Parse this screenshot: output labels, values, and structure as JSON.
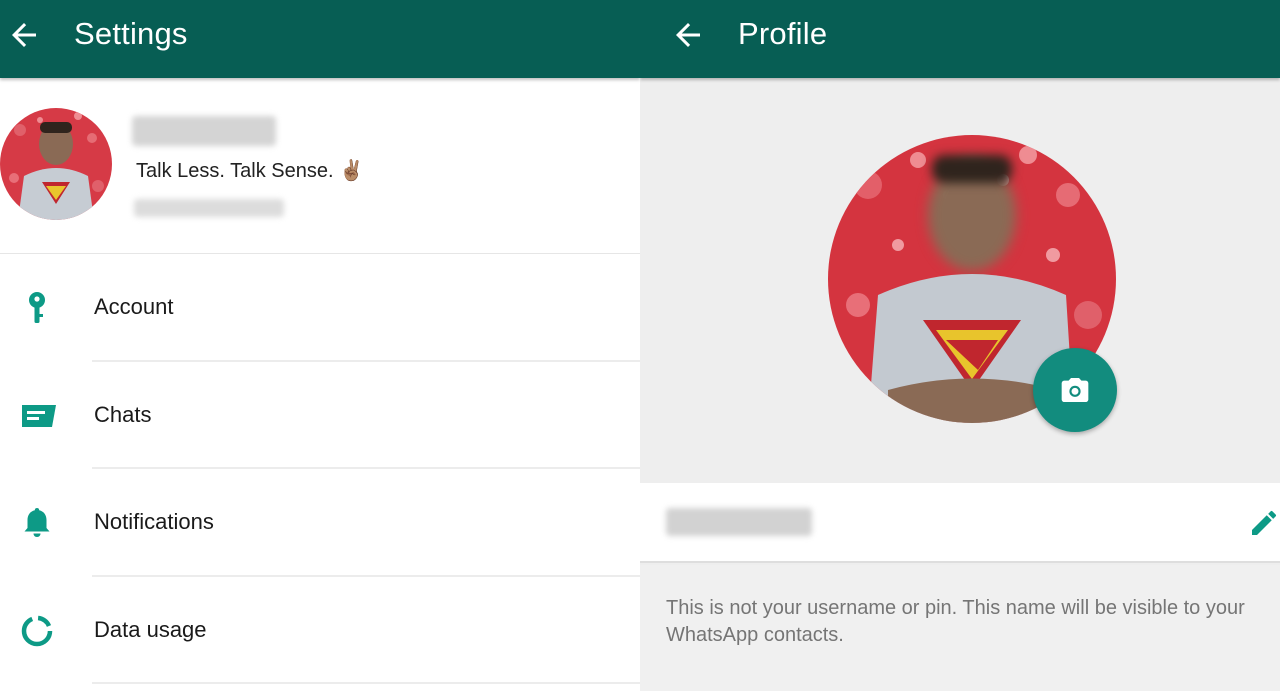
{
  "settings_screen": {
    "title": "Settings",
    "profile": {
      "status": "Talk Less. Talk Sense. ✌🏽"
    },
    "items": [
      {
        "label": "Account",
        "icon": "key-icon"
      },
      {
        "label": "Chats",
        "icon": "chat-icon"
      },
      {
        "label": "Notifications",
        "icon": "bell-icon"
      },
      {
        "label": "Data usage",
        "icon": "data-usage-icon"
      }
    ]
  },
  "profile_screen": {
    "title": "Profile",
    "hint": "This is not your username or pin. This name will be visible to your WhatsApp contacts."
  },
  "colors": {
    "toolbar": "#075e54",
    "accent": "#128c7e",
    "icon_teal": "#0d9a86"
  }
}
